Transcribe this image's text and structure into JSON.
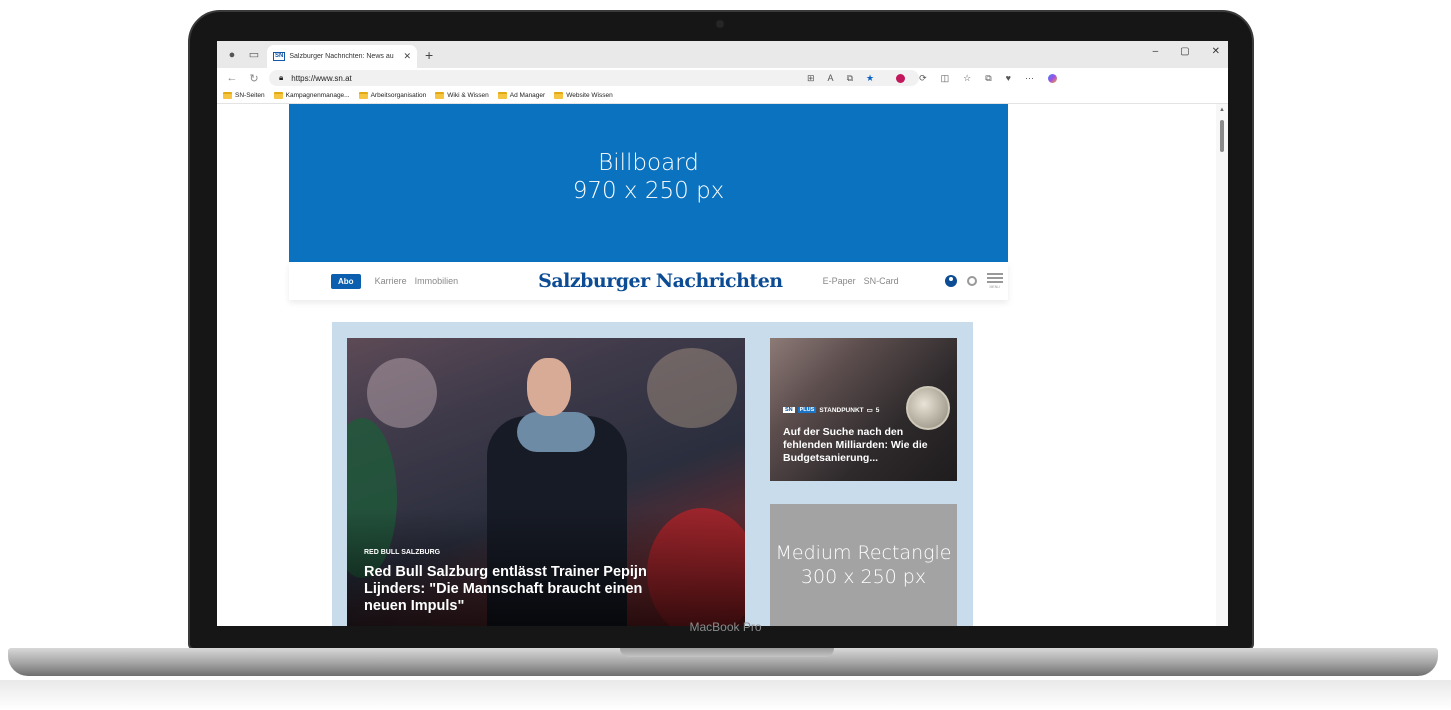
{
  "browser": {
    "tab_title": "Salzburger Nachrichten: News au",
    "tab_favicon": "SN",
    "new_tab": "+",
    "url": "https://www.sn.at",
    "bookmarks": [
      "SN-Seiten",
      "Kampagnenmanage...",
      "Arbeitsorganisation",
      "Wiki & Wissen",
      "Ad Manager",
      "Website Wissen"
    ]
  },
  "ads": {
    "billboard_line1": "Billboard",
    "billboard_line2": "970 x 250 px",
    "medrect_line1": "Medium Rectangle",
    "medrect_line2": "300 x 250 px"
  },
  "header": {
    "abo": "Abo",
    "link_karriere": "Karriere",
    "link_immobilien": "Immobilien",
    "logo": "Salzburger Nachrichten",
    "link_epaper": "E-Paper",
    "link_sncard": "SN-Card",
    "menu_caption": "MENU"
  },
  "hero": {
    "kicker": "RED BULL SALZBURG",
    "title": "Red Bull Salzburg entlässt Trainer Pepijn Lijnders: \"Die Mannschaft braucht einen neuen Impuls\""
  },
  "side": {
    "badge_sn": "SN",
    "badge_plus": "PLUS",
    "kicker": "STANDPUNKT",
    "comments": "5",
    "title": "Auf der Suche nach den fehlenden Milliarden: Wie die Budgetsanierung..."
  },
  "device": {
    "label": "MacBook Pro"
  },
  "colors": {
    "billboard": "#0b72c0",
    "sn_blue": "#0b4c94",
    "content_bg": "#c9dcec",
    "medrect": "#a3a3a3"
  }
}
